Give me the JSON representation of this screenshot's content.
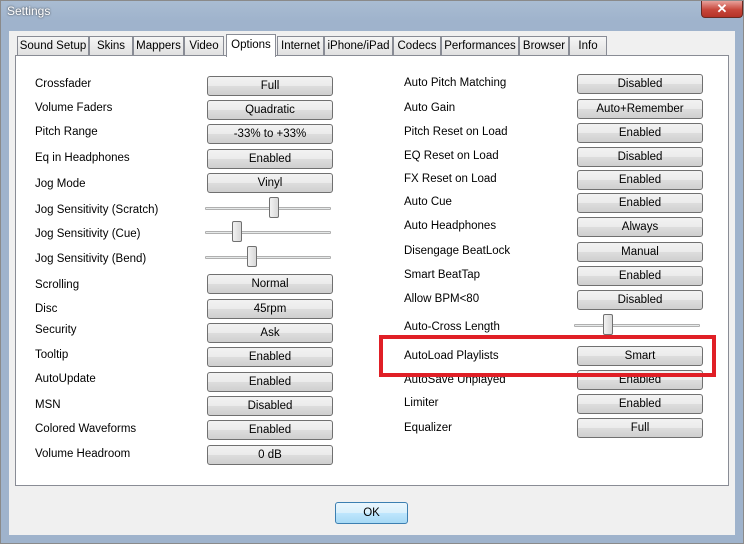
{
  "window": {
    "title": "Settings",
    "close_symbol": "✕"
  },
  "tabs": [
    {
      "label": "Sound Setup"
    },
    {
      "label": "Skins"
    },
    {
      "label": "Mappers"
    },
    {
      "label": "Video"
    },
    {
      "label": "Options",
      "active": true
    },
    {
      "label": "Internet"
    },
    {
      "label": "iPhone/iPad"
    },
    {
      "label": "Codecs"
    },
    {
      "label": "Performances"
    },
    {
      "label": "Browser"
    },
    {
      "label": "Info"
    }
  ],
  "left": {
    "crossfader": {
      "label": "Crossfader",
      "value": "Full"
    },
    "volume_faders": {
      "label": "Volume Faders",
      "value": "Quadratic"
    },
    "pitch_range": {
      "label": "Pitch Range",
      "value": "-33% to +33%"
    },
    "eq_headphones": {
      "label": "Eq in Headphones",
      "value": "Enabled"
    },
    "jog_mode": {
      "label": "Jog Mode",
      "value": "Vinyl"
    },
    "jog_scratch": {
      "label": "Jog Sensitivity (Scratch)",
      "level": 0.55
    },
    "jog_cue": {
      "label": "Jog Sensitivity (Cue)",
      "level": 0.23
    },
    "jog_bend": {
      "label": "Jog Sensitivity (Bend)",
      "level": 0.36
    },
    "scrolling": {
      "label": "Scrolling",
      "value": "Normal"
    },
    "disc": {
      "label": "Disc",
      "value": "45rpm"
    },
    "security": {
      "label": "Security",
      "value": "Ask"
    },
    "tooltip": {
      "label": "Tooltip",
      "value": "Enabled"
    },
    "autoupdate": {
      "label": "AutoUpdate",
      "value": "Enabled"
    },
    "msn": {
      "label": "MSN",
      "value": "Disabled"
    },
    "colored_waveforms": {
      "label": "Colored Waveforms",
      "value": "Enabled"
    },
    "volume_headroom": {
      "label": "Volume Headroom",
      "value": "0 dB"
    }
  },
  "right": {
    "auto_pitch_matching": {
      "label": "Auto Pitch Matching",
      "value": "Disabled"
    },
    "auto_gain": {
      "label": "Auto Gain",
      "value": "Auto+Remember"
    },
    "pitch_reset": {
      "label": "Pitch Reset on Load",
      "value": "Enabled"
    },
    "eq_reset": {
      "label": "EQ Reset on Load",
      "value": "Disabled"
    },
    "fx_reset": {
      "label": "FX Reset on Load",
      "value": "Enabled"
    },
    "auto_cue": {
      "label": "Auto Cue",
      "value": "Enabled"
    },
    "auto_headphones": {
      "label": "Auto Headphones",
      "value": "Always"
    },
    "disengage_beatlock": {
      "label": "Disengage BeatLock",
      "value": "Manual"
    },
    "smart_beattap": {
      "label": "Smart BeatTap",
      "value": "Enabled"
    },
    "allow_bpm": {
      "label": "Allow BPM<80",
      "value": "Disabled"
    },
    "auto_cross_length": {
      "label": "Auto-Cross Length",
      "level": 0.25
    },
    "autoload_playlists": {
      "label": "AutoLoad Playlists",
      "value": "Smart"
    },
    "autosave_unplayed": {
      "label": "AutoSave Unplayed",
      "value": "Enabled"
    },
    "limiter": {
      "label": "Limiter",
      "value": "Enabled"
    },
    "equalizer": {
      "label": "Equalizer",
      "value": "Full"
    }
  },
  "ok_label": "OK",
  "colors": {
    "highlight": "#e01f26",
    "titlebar": "#9fb3cc",
    "close": "#c7463a"
  }
}
